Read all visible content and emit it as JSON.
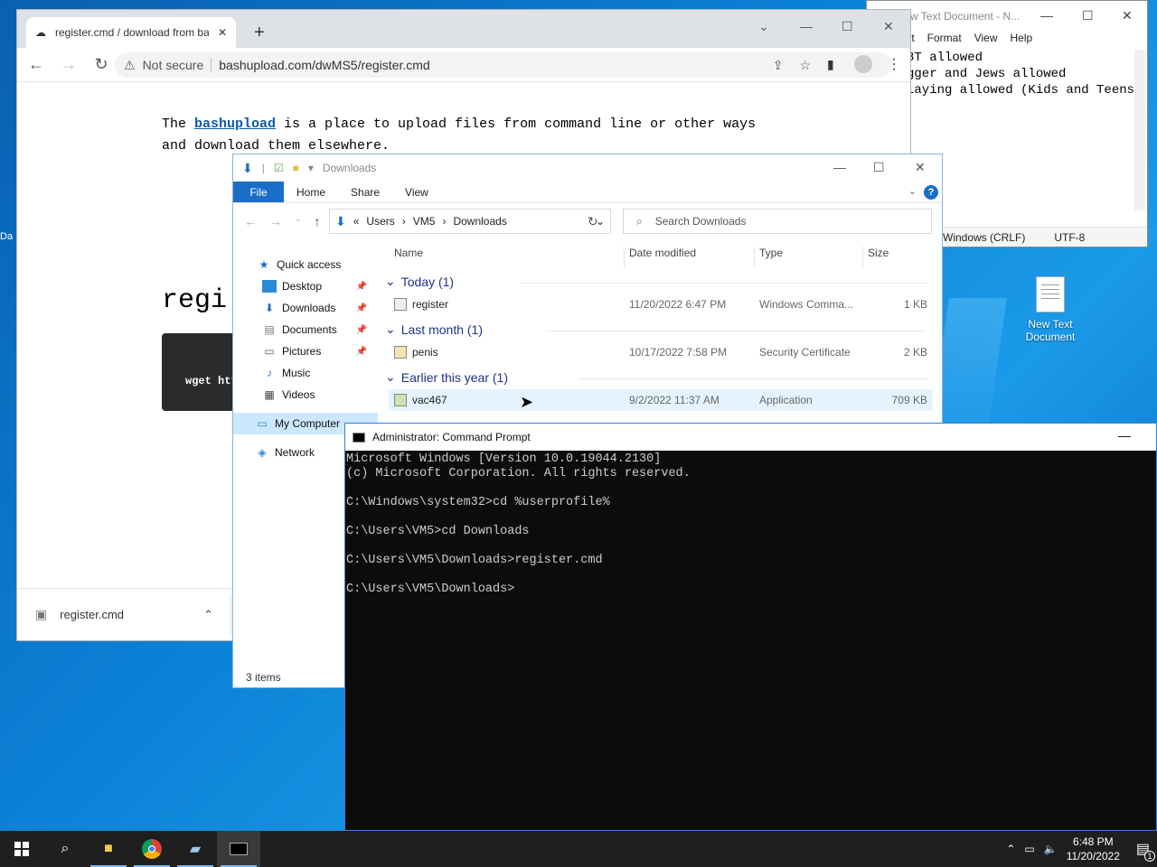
{
  "desktop": {
    "new_text_doc_label": "New Text\nDocument",
    "left_icon_labels": [
      "Da"
    ]
  },
  "notepad": {
    "title": "w Text Document - N...",
    "menu": [
      "lit",
      "Format",
      "View",
      "Help"
    ],
    "lines": [
      "3T allowed",
      "gger and Jews allowed",
      "laying allowed (Kids and Teens)"
    ],
    "status_eol": "Windows (CRLF)",
    "status_enc": "UTF-8"
  },
  "chrome": {
    "tab_title": "register.cmd / download from ba",
    "not_secure": "Not secure",
    "url": "bashupload.com/dwMS5/register.cmd",
    "para_prefix": "The ",
    "para_link": "bashupload",
    "para_suffix": " is a place to upload files from command line or other ways and download them elsewhere.",
    "heading_partial": "regi",
    "code_partial": "wget htt",
    "download_file": "register.cmd"
  },
  "explorer": {
    "title": "Downloads",
    "ribbon": [
      "File",
      "Home",
      "Share",
      "View"
    ],
    "breadcrumb": [
      "Users",
      "VM5",
      "Downloads"
    ],
    "search_placeholder": "Search Downloads",
    "nav": [
      {
        "label": "Quick access",
        "icon": "star-icon"
      },
      {
        "label": "Desktop",
        "icon": "desktop-icon",
        "pinned": true
      },
      {
        "label": "Downloads",
        "icon": "download-icon",
        "pinned": true
      },
      {
        "label": "Documents",
        "icon": "documents-icon",
        "pinned": true
      },
      {
        "label": "Pictures",
        "icon": "pictures-icon",
        "pinned": true
      },
      {
        "label": "Music",
        "icon": "music-icon"
      },
      {
        "label": "Videos",
        "icon": "videos-icon"
      },
      {
        "label": "My Computer",
        "icon": "computer-icon"
      },
      {
        "label": "Network",
        "icon": "network-icon"
      }
    ],
    "columns": [
      "Name",
      "Date modified",
      "Type",
      "Size"
    ],
    "groups": [
      {
        "label": "Today (1)",
        "files": [
          {
            "name": "register",
            "date": "11/20/2022 6:47 PM",
            "type": "Windows Comma...",
            "size": "1 KB"
          }
        ]
      },
      {
        "label": "Last month (1)",
        "files": [
          {
            "name": "penis",
            "date": "10/17/2022 7:58 PM",
            "type": "Security Certificate",
            "size": "2 KB"
          }
        ]
      },
      {
        "label": "Earlier this year (1)",
        "files": [
          {
            "name": "vac467",
            "date": "9/2/2022 11:37 AM",
            "type": "Application",
            "size": "709 KB"
          }
        ]
      }
    ],
    "status": "3 items"
  },
  "cmd": {
    "title": "Administrator: Command Prompt",
    "output": "Microsoft Windows [Version 10.0.19044.2130]\n(c) Microsoft Corporation. All rights reserved.\n\nC:\\Windows\\system32>cd %userprofile%\n\nC:\\Users\\VM5>cd Downloads\n\nC:\\Users\\VM5\\Downloads>register.cmd\n\nC:\\Users\\VM5\\Downloads>"
  },
  "taskbar": {
    "time": "6:48 PM",
    "date": "11/20/2022",
    "notification_count": "1"
  }
}
